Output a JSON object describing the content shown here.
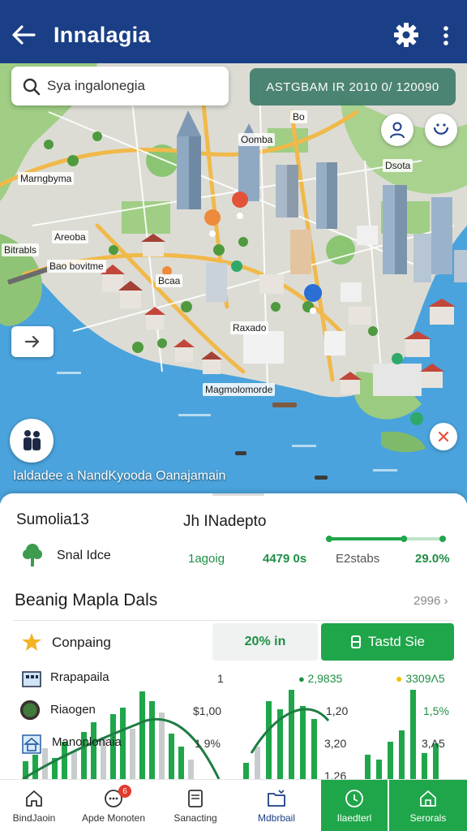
{
  "app_bar": {
    "title": "Innalagia"
  },
  "map": {
    "search": {
      "value": "Sya ingalonegia"
    },
    "coords_text": "ASTGBAM  IR 2010 0/ 120090",
    "labels": [
      "Marngbyma",
      "Areoba",
      "Bao bovitme",
      "Bitrabls",
      "Bcaa",
      "Oomba",
      "Bo",
      "Raxado",
      "Dsota",
      "Magmolomorde"
    ],
    "caption": "Ialdadee a NandKyooda Oanajamain"
  },
  "sheet": {
    "left_title": "Sumolia13",
    "mid_title": "Jh INadepto",
    "tree_label": "Snal Idce",
    "progress": 0.65,
    "stats": [
      "1agoig",
      "4479 0s",
      "E2stabs",
      "29.0%"
    ],
    "section_title": "Beanig Mapla Dals",
    "section_more": "2996",
    "row_title": "Conpaing",
    "chip_label": "20% in",
    "cta_label": "Tastd Sie",
    "rows": [
      "Rrapapaila",
      "Riaogen",
      "Manonlonaia"
    ],
    "col1_numbers": [
      "1",
      "$1,00",
      "1 9%"
    ],
    "col2_numbers": [
      "2,9835",
      "1,20",
      "3,20",
      "1,26"
    ],
    "col3_numbers": [
      "3309Λ5",
      "1,5%",
      "3,Λ5"
    ],
    "colors": {
      "green": "#1fa64a",
      "navy": "#1b3f86",
      "chart_gray": "#c9cccc"
    }
  },
  "nav": {
    "items": [
      {
        "label": "BindJaoin",
        "icon": "home-icon"
      },
      {
        "label": "Apde Monoten",
        "icon": "chat-icon",
        "badge": "6"
      },
      {
        "label": "Sanacting",
        "icon": "document-icon"
      },
      {
        "label": "Mdbrbail",
        "icon": "folder-icon"
      },
      {
        "label": "Ilaedterl",
        "icon": "compass-icon"
      },
      {
        "label": "Serorals",
        "icon": "building-icon"
      }
    ]
  }
}
